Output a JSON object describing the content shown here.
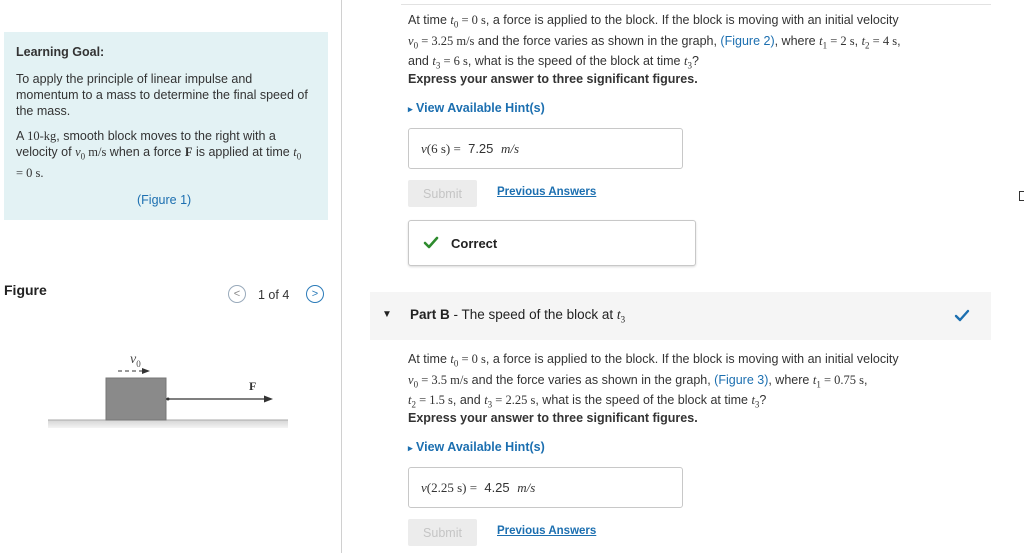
{
  "goal": {
    "title": "Learning Goal:",
    "description": "To apply the principle of linear impulse and momentum to a mass to determine the final speed of the mass.",
    "problem_mass": "10-kg",
    "problem_pre": "A ",
    "problem_mid": ", smooth block moves to the right with a velocity of ",
    "problem_v": "v",
    "problem_sub0": "0",
    "problem_unit": " m/s",
    "problem_when": " when a force ",
    "problem_F": "F",
    "problem_applied": " is applied at time ",
    "problem_t": "t",
    "problem_eq": " = 0 s.",
    "figure_link": "(Figure 1)"
  },
  "figure": {
    "heading": "Figure",
    "pager": "1 of 4",
    "prev_icon": "<",
    "next_icon": ">",
    "label_v": "v",
    "label_v_sub": "0",
    "label_F": "F"
  },
  "partA": {
    "q_line1_a": "At time ",
    "q_line1_t0": "t",
    "q_line1_b": "0",
    "q_line1_c": " = 0 s",
    "q_line1_d": ", a force is applied to the block. If the block is moving with an initial velocity",
    "q_line2_v": "v",
    "q_line2_sub": "0",
    "q_line2_val": " = 3.25 m/s",
    "q_line2_b": " and the force varies as shown in the graph, ",
    "q_line2_link": "(Figure 2)",
    "q_line2_c": ", where ",
    "q_line2_t1": "t",
    "q_line2_t1s": "1",
    "q_line2_t1v": " = 2 s",
    "q_line2_comma": ", ",
    "q_line2_t2": "t",
    "q_line2_t2s": "2",
    "q_line2_t2v": " = 4 s",
    "q_line2_end": ",",
    "q_line3_a": "and ",
    "q_line3_t3": "t",
    "q_line3_t3s": "3",
    "q_line3_t3v": " = 6 s",
    "q_line3_b": ", what is the speed of the block at time ",
    "q_line3_t": "t",
    "q_line3_ts": "3",
    "q_line3_q": "?",
    "express": "Express your answer to three significant figures.",
    "hint": "View Available Hint(s)",
    "answer_label": "v(6 s) =",
    "answer_value": "7.25",
    "answer_unit": "m/s",
    "submit": "Submit",
    "previous": "Previous Answers",
    "result": "Correct"
  },
  "partB": {
    "label_bold": "Part B",
    "label_rest": " - The speed of the block at ",
    "label_t": "t",
    "label_sub": "3",
    "q_line1_a": "At time ",
    "q_line1_t0": "t",
    "q_line1_b": "0",
    "q_line1_c": " = 0 s",
    "q_line1_d": ", a force is applied to the block. If the block is moving with an initial velocity",
    "q_line2_v": "v",
    "q_line2_sub": "0",
    "q_line2_val": " = 3.5 m/s",
    "q_line2_b": " and the force varies as shown in the graph, ",
    "q_line2_link": "(Figure 3)",
    "q_line2_c": ", where ",
    "q_line2_t1": "t",
    "q_line2_t1s": "1",
    "q_line2_t1v": " = 0.75 s",
    "q_line2_end": ",",
    "q_line3_t2": "t",
    "q_line3_t2s": "2",
    "q_line3_t2v": " = 1.5 s",
    "q_line3_a": ", and ",
    "q_line3_t3": "t",
    "q_line3_t3s": "3",
    "q_line3_t3v": " = 2.25 s",
    "q_line3_b": ", what is the speed of the block at time ",
    "q_line3_t": "t",
    "q_line3_ts": "3",
    "q_line3_q": "?",
    "express": "Express your answer to three significant figures.",
    "hint": "View Available Hint(s)",
    "answer_label": "v(2.25 s) =",
    "answer_value": "4.25",
    "answer_unit": "m/s",
    "submit": "Submit",
    "previous": "Previous Answers"
  },
  "colors": {
    "link": "#1c6fb0",
    "goal_bg": "#e3f2f4",
    "check_green": "#2e8b2e",
    "check_blue": "#1c6fb0"
  }
}
